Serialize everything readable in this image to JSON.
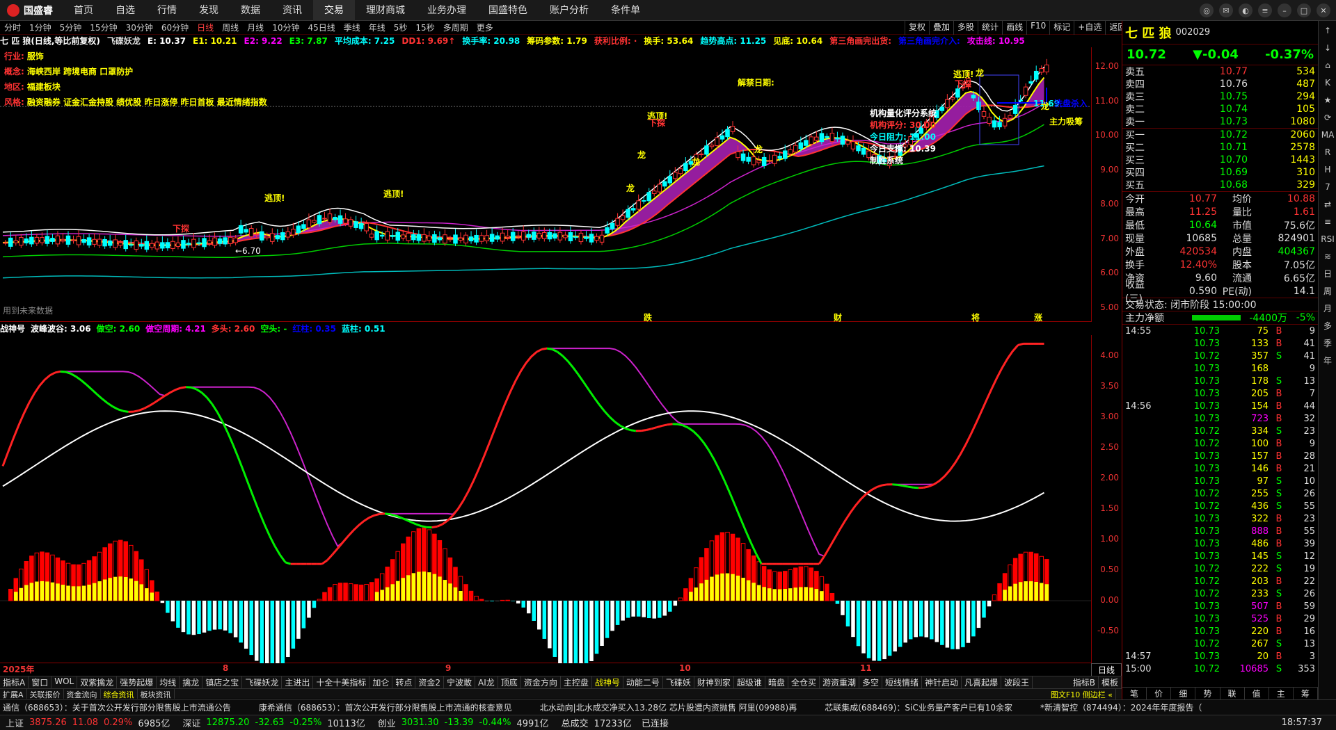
{
  "app": {
    "name": "国盛睿"
  },
  "nav": [
    "首页",
    "自选",
    "行情",
    "发现",
    "数据",
    "资讯",
    "交易",
    "理财商城",
    "业务办理",
    "国盛特色",
    "账户分析",
    "条件单"
  ],
  "nav_active": 6,
  "periods": [
    "分时",
    "1分钟",
    "5分钟",
    "15分钟",
    "30分钟",
    "60分钟",
    "日线",
    "周线",
    "月线",
    "10分钟",
    "45日线",
    "季线",
    "年线",
    "5秒",
    "15秒",
    "多周期",
    "更多"
  ],
  "period_active": 6,
  "ops": [
    "复权",
    "叠加",
    "多股",
    "统计",
    "画线",
    "F10",
    "标记",
    "+自选",
    "返回"
  ],
  "indicators_main": [
    {
      "t": "七 匹 狼(日线,等比前复权)",
      "c": "#fff"
    },
    {
      "t": "飞碟妖龙",
      "c": "#ddd"
    },
    {
      "t": "E: 10.37",
      "c": "#fff"
    },
    {
      "t": "E1: 10.21",
      "c": "#ff0"
    },
    {
      "t": "E2: 9.22",
      "c": "#f0f"
    },
    {
      "t": "E3: 7.87",
      "c": "#0f0"
    },
    {
      "t": "平均成本: 7.25",
      "c": "#0ff"
    },
    {
      "t": "DD1: 9.69↑",
      "c": "#f33"
    },
    {
      "t": "换手率: 20.98",
      "c": "#0ff"
    },
    {
      "t": "筹码参数: 1.79",
      "c": "#ff0"
    },
    {
      "t": "获利比例: ·",
      "c": "#f33"
    },
    {
      "t": "换手: 53.64",
      "c": "#ff0"
    },
    {
      "t": "趋势高点: 11.25",
      "c": "#0ff"
    },
    {
      "t": "见底: 10.64",
      "c": "#ff0"
    },
    {
      "t": "第三角画完出货:",
      "c": "#f33"
    },
    {
      "t": "第三角画完介入:",
      "c": "#00f"
    },
    {
      "t": "攻击线: 10.95",
      "c": "#f0f"
    }
  ],
  "info_lines": [
    {
      "k": "行业:",
      "v": "服饰"
    },
    {
      "k": "概念:",
      "v": "海峡西岸 跨境电商 口罩防护"
    },
    {
      "k": "地区:",
      "v": "福建板块"
    },
    {
      "k": "风格:",
      "v": "融资融券 证金汇金持股 绩优股 昨日涨停 昨日首板 最近情绪指数"
    }
  ],
  "unlock_label": "解禁日期:",
  "future_note": "用到未来数据",
  "eval": {
    "title": "机构量化评分系统",
    "score": "机构评分: 30.00",
    "res": "今日阻力: 11.00",
    "sup": "今日支撑: 10.39",
    "sys": "制胜系统"
  },
  "chart_labels": {
    "escape": "逃顶!",
    "dragon": "龙",
    "bottom": "下探",
    "low_marker": "←6.70",
    "high_marker": "11.69",
    "wash": "洗盘杀入",
    "main_buy": "主力吸筹",
    "events": [
      "跌",
      "财",
      "将",
      "涨"
    ]
  },
  "price_ticks": [
    "12.00",
    "11.00",
    "10.00",
    "9.00",
    "8.00",
    "7.00",
    "6.00",
    "5.00"
  ],
  "sub_indicators": [
    {
      "t": "战神号",
      "c": "#fff"
    },
    {
      "t": "波峰波谷: 3.06",
      "c": "#fff"
    },
    {
      "t": "做空: 2.60",
      "c": "#0f0"
    },
    {
      "t": "做空周期: 4.21",
      "c": "#f0f"
    },
    {
      "t": "多头: 2.60",
      "c": "#f33"
    },
    {
      "t": "空头: -",
      "c": "#0f0"
    },
    {
      "t": "红柱: 0.35",
      "c": "#00f"
    },
    {
      "t": "蓝柱: 0.51",
      "c": "#0ff"
    }
  ],
  "sub_ticks": [
    "4.00",
    "3.50",
    "3.00",
    "2.50",
    "2.00",
    "1.50",
    "1.00",
    "0.50",
    "0.00",
    "-0.50"
  ],
  "date_labels": [
    "2025年",
    "8",
    "9",
    "10",
    "11"
  ],
  "date_week": "日线",
  "tabs": [
    "指标A",
    "窗口",
    "WOL",
    "双紫擒龙",
    "强势起爆",
    "均线",
    "擒龙",
    "镇店之宝",
    "飞碟妖龙",
    "主进出",
    "十全十美指标",
    "加仑",
    "转点",
    "资金2",
    "宁波敢",
    "AI龙",
    "顶底",
    "资金方向",
    "主控盘",
    "战神号",
    "动能二号",
    "飞碟妖",
    "财神到家",
    "超级谁",
    "暗盘",
    "全仓买",
    "游资重潮",
    "多空",
    "短线情绪",
    "神针启动",
    "凡喜起爆",
    "波段王"
  ],
  "tabs_active": 19,
  "tabs_right": [
    "指标B",
    "模板"
  ],
  "tabs2": [
    "扩展A",
    "关联报价",
    "资金流向",
    "综合资讯",
    "板块资讯"
  ],
  "tabs2_active": 3,
  "tabs2_right": "图文F10 侧边栏 «",
  "quote": {
    "name": "七 匹 狼",
    "code": "002029",
    "price": "10.72",
    "change": "▼-0.04",
    "pct": "-0.37%",
    "sells": [
      [
        "卖五",
        "10.77",
        "534"
      ],
      [
        "卖四",
        "10.76",
        "487"
      ],
      [
        "卖三",
        "10.75",
        "294"
      ],
      [
        "卖二",
        "10.74",
        "105"
      ],
      [
        "卖一",
        "10.73",
        "1080"
      ]
    ],
    "buys": [
      [
        "买一",
        "10.72",
        "2060"
      ],
      [
        "买二",
        "10.71",
        "2578"
      ],
      [
        "买三",
        "10.70",
        "1443"
      ],
      [
        "买四",
        "10.69",
        "310"
      ],
      [
        "买五",
        "10.68",
        "329"
      ]
    ],
    "stats": [
      [
        "今开",
        "10.77",
        "均价",
        "10.88"
      ],
      [
        "最高",
        "11.25",
        "量比",
        "1.61"
      ],
      [
        "最低",
        "10.64",
        "市值",
        "75.6亿"
      ],
      [
        "现量",
        "10685",
        "总量",
        "824901"
      ],
      [
        "外盘",
        "420534",
        "内盘",
        "404367"
      ],
      [
        "换手",
        "12.40%",
        "股本",
        "7.05亿"
      ],
      [
        "净资",
        "9.60",
        "流通",
        "6.65亿"
      ],
      [
        "收益(三)",
        "0.590",
        "PE(动)",
        "14.1"
      ]
    ],
    "state": "交易状态: 闭市阶段 15:00:00",
    "netflow_label": "主力净额",
    "netflow": "-4400万",
    "netflow_pct": "-5%"
  },
  "ticks": [
    [
      "14:55",
      "10.73",
      "75",
      "B",
      "9"
    ],
    [
      "",
      "10.73",
      "133",
      "B",
      "41"
    ],
    [
      "",
      "10.72",
      "357",
      "S",
      "41"
    ],
    [
      "",
      "10.73",
      "168",
      "",
      "9"
    ],
    [
      "",
      "10.73",
      "178",
      "S",
      "13"
    ],
    [
      "",
      "10.73",
      "205",
      "B",
      "7"
    ],
    [
      "14:56",
      "10.73",
      "154",
      "B",
      "44"
    ],
    [
      "",
      "10.73",
      "723",
      "B",
      "32"
    ],
    [
      "",
      "10.72",
      "334",
      "S",
      "23"
    ],
    [
      "",
      "10.72",
      "100",
      "B",
      "9"
    ],
    [
      "",
      "10.73",
      "157",
      "B",
      "28"
    ],
    [
      "",
      "10.73",
      "146",
      "B",
      "21"
    ],
    [
      "",
      "10.73",
      "97",
      "S",
      "10"
    ],
    [
      "",
      "10.72",
      "255",
      "S",
      "26"
    ],
    [
      "",
      "10.72",
      "436",
      "S",
      "55"
    ],
    [
      "",
      "10.73",
      "322",
      "B",
      "23"
    ],
    [
      "",
      "10.73",
      "888",
      "B",
      "55"
    ],
    [
      "",
      "10.73",
      "486",
      "B",
      "39"
    ],
    [
      "",
      "10.73",
      "145",
      "S",
      "12"
    ],
    [
      "",
      "10.72",
      "222",
      "S",
      "19"
    ],
    [
      "",
      "10.72",
      "203",
      "B",
      "22"
    ],
    [
      "",
      "10.72",
      "233",
      "S",
      "26"
    ],
    [
      "",
      "10.73",
      "507",
      "B",
      "59"
    ],
    [
      "",
      "10.73",
      "525",
      "B",
      "29"
    ],
    [
      "",
      "10.73",
      "220",
      "B",
      "16"
    ],
    [
      "",
      "10.72",
      "267",
      "S",
      "13"
    ],
    [
      "14:57",
      "10.73",
      "20",
      "B",
      "3"
    ],
    [
      "15:00",
      "10.72",
      "10685",
      "S",
      "353"
    ]
  ],
  "rp_foot": [
    "笔",
    "价",
    "细",
    "势",
    "联",
    "值",
    "主",
    "筹"
  ],
  "sidebar": [
    "↑",
    "↓",
    "⌂",
    "K",
    "★",
    "⟳",
    "MA",
    "R",
    "H",
    "7",
    "⇄",
    "≡",
    "RSI",
    "≋",
    "日",
    "周",
    "月",
    "多",
    "季",
    "年"
  ],
  "news": [
    "通信（688653）：关于首次公开发行部分限售股上市流通公告",
    "康希通信（688653）：首次公开发行部分限售股上市流通的核查意见",
    "北水动向|北水成交净买入13.28亿 芯片股遭内资抛售 阿里(09988)再",
    "芯联集成(688469)：SiC业务量产客户已有10余家",
    "*新清智控（874494）：2024年年度报告（"
  ],
  "status": {
    "sh_label": "上证",
    "sh_val": "3875.26",
    "sh_ch": "11.08",
    "sh_pct": "0.29%",
    "sh_amt": "6985亿",
    "sz_label": "深证",
    "sz_val": "12875.20",
    "sz_ch": "-32.63",
    "sz_pct": "-0.25%",
    "sz_amt": "10113亿",
    "cy_label": "创业",
    "cy_val": "3031.30",
    "cy_ch": "-13.39",
    "cy_pct": "-0.44%",
    "cy_amt": "4991亿",
    "total_label": "总成交",
    "total": "17233亿",
    "conn": "已连接",
    "time": "18:57:37"
  },
  "colors": {
    "up": "#ff3333",
    "down": "#00e000",
    "magenta": "#cc22cc",
    "yellow": "#ffff00",
    "cyan": "#00ffff"
  }
}
